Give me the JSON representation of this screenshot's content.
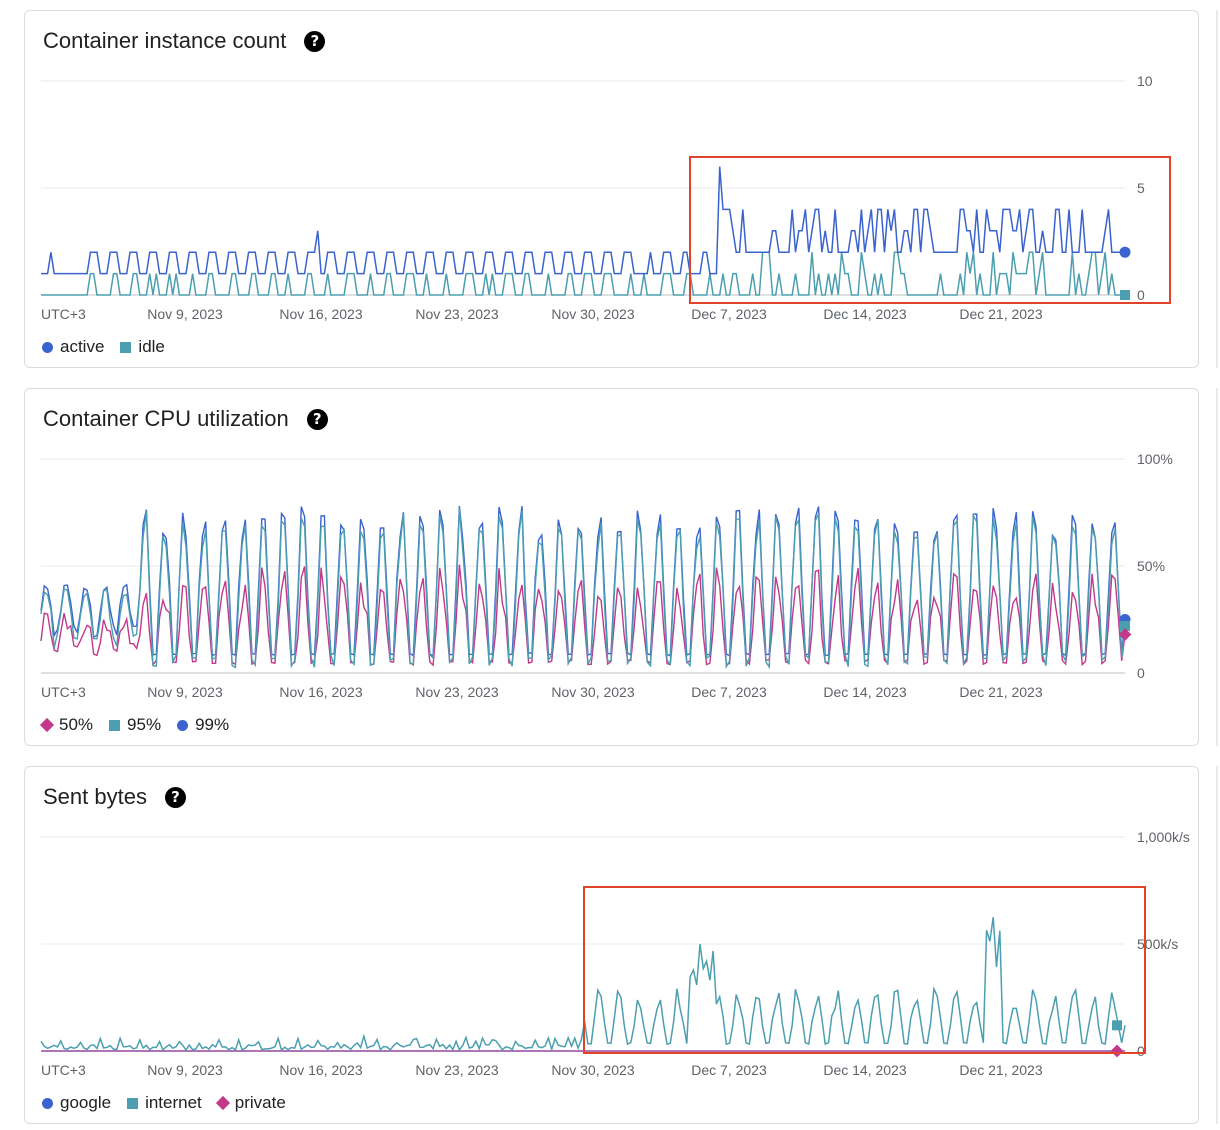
{
  "colors": {
    "blue": "#3a63cf",
    "teal": "#4b9fb0",
    "magenta": "#c2388a",
    "highlight": "#e0422a",
    "grid": "#e8eaed",
    "axis": "#bdc1c6"
  },
  "x_axis": {
    "tz_label": "UTC+3",
    "ticks": [
      "Nov 9, 2023",
      "Nov 16, 2023",
      "Nov 23, 2023",
      "Nov 30, 2023",
      "Dec 7, 2023",
      "Dec 14, 2023",
      "Dec 21, 2023"
    ]
  },
  "help_icon_glyph": "?",
  "chart_data": [
    {
      "type": "line",
      "title": "Container instance count",
      "x_range": [
        "2023-11-03",
        "2023-12-28"
      ],
      "ylim": [
        0,
        10
      ],
      "y_ticks": [
        "10",
        "5",
        "0"
      ],
      "highlight_x": [
        "2023-12-06",
        "2023-12-28"
      ],
      "series": [
        {
          "name": "active",
          "marker": "circle",
          "color": "#3a63cf",
          "values_desc": "step pattern",
          "baseline": 1,
          "peak_period": 2,
          "last": 2
        },
        {
          "name": "idle",
          "marker": "square",
          "color": "#4b9fb0",
          "baseline": 0,
          "last": 0
        }
      ]
    },
    {
      "type": "line",
      "title": "Container CPU utilization",
      "x_range": [
        "2023-11-03",
        "2023-12-28"
      ],
      "ylim": [
        0,
        100
      ],
      "y_ticks": [
        "100%",
        "50%",
        "0"
      ],
      "series": [
        {
          "name": "50%",
          "marker": "diamond",
          "color": "#c2388a",
          "last": 18
        },
        {
          "name": "95%",
          "marker": "square",
          "color": "#4b9fb0",
          "last": 22
        },
        {
          "name": "99%",
          "marker": "circle",
          "color": "#3a63cf",
          "last": 25
        }
      ]
    },
    {
      "type": "line",
      "title": "Sent bytes",
      "x_range": [
        "2023-11-03",
        "2023-12-28"
      ],
      "ylim": [
        0,
        1000
      ],
      "y_ticks": [
        "1,000k/s",
        "500k/s",
        "0"
      ],
      "highlight_x": [
        "2023-11-29",
        "2023-12-28"
      ],
      "series": [
        {
          "name": "google",
          "marker": "circle",
          "color": "#3a63cf",
          "last": 0
        },
        {
          "name": "internet",
          "marker": "square",
          "color": "#4b9fb0",
          "last": 120
        },
        {
          "name": "private",
          "marker": "diamond",
          "color": "#c2388a",
          "last": 0
        }
      ]
    }
  ]
}
